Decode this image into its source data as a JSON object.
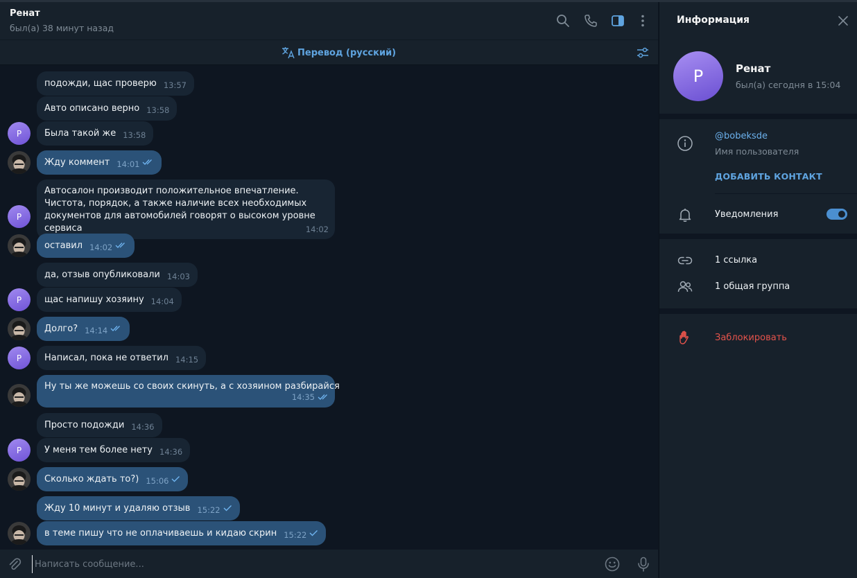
{
  "chat": {
    "title": "Ренат",
    "status": "был(а) 38 минут назад",
    "translate_label": "Перевод (русский)",
    "input_placeholder": "Написать сообщение...",
    "messages": [
      {
        "text": "подожди, щас проверю",
        "time": "13:57",
        "out": false
      },
      {
        "text": "Авто описано верно",
        "time": "13:58",
        "out": false
      },
      {
        "text": "Была такой же",
        "time": "13:58",
        "out": false,
        "avatar": "Р"
      },
      {
        "text": "Жду коммент",
        "time": "14:01",
        "out": true,
        "read": true
      },
      {
        "text": "Автосалон производит положительное впечатление. Чистота, порядок, а также наличие всех необходимых документов для автомобилей говорят о высоком уровне сервиса",
        "time": "14:02",
        "out": false,
        "avatar": "Р"
      },
      {
        "text": "оставил",
        "time": "14:02",
        "out": true,
        "read": true
      },
      {
        "text": "да, отзыв опубликовали",
        "time": "14:03",
        "out": false
      },
      {
        "text": "щас напишу хозяину",
        "time": "14:04",
        "out": false,
        "avatar": "Р"
      },
      {
        "text": "Долго?",
        "time": "14:14",
        "out": true,
        "read": true
      },
      {
        "text": "Написал, пока не ответил",
        "time": "14:15",
        "out": false,
        "avatar": "Р"
      },
      {
        "text": "Ну ты же можешь со своих скинуть, а с хозяином разбирайся",
        "time": "14:35",
        "out": true,
        "read": true
      },
      {
        "text": "Просто подожди",
        "time": "14:36",
        "out": false
      },
      {
        "text": "У меня тем более нету",
        "time": "14:36",
        "out": false,
        "avatar": "Р"
      },
      {
        "text": "Сколько ждать то?)",
        "time": "15:06",
        "out": true,
        "read": false
      },
      {
        "text": "Жду 10 минут и удаляю отзыв",
        "time": "15:22",
        "out": true,
        "read": false
      },
      {
        "text": "в теме пишу что не оплачиваешь и кидаю скрин",
        "time": "15:22",
        "out": true,
        "read": false
      }
    ]
  },
  "info": {
    "title": "Информация",
    "avatar_letter": "Р",
    "name": "Ренат",
    "seen": "был(а) сегодня в 15:04",
    "username": "@bobeksde",
    "username_label": "Имя пользователя",
    "add_contact": "ДОБАВИТЬ КОНТАКТ",
    "notifications_label": "Уведомления",
    "notifications_on": true,
    "links": "1 ссылка",
    "groups": "1 общая группа",
    "block": "Заблокировать"
  },
  "colors": {
    "accent": "#5fa4e0",
    "incoming_bubble": "#182533",
    "outgoing_bubble": "#2b5278",
    "danger": "#e5534b"
  }
}
